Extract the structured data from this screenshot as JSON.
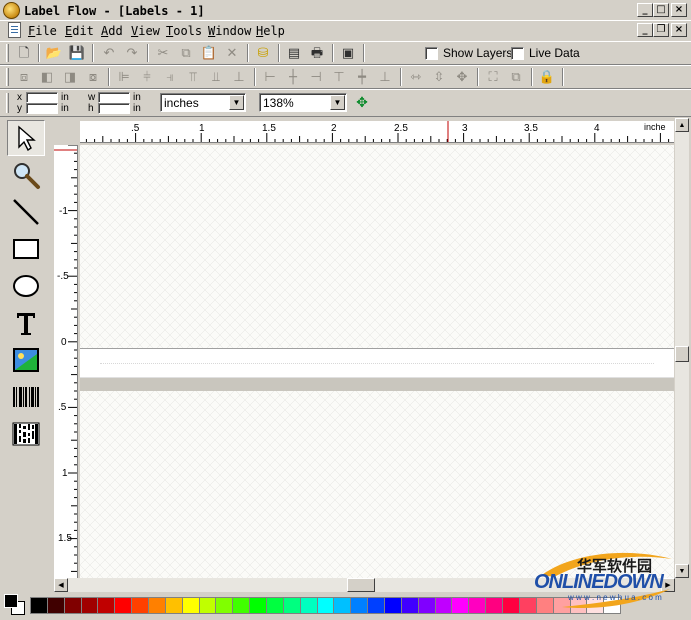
{
  "window": {
    "title": "Label Flow - [Labels - 1]"
  },
  "menus": [
    "File",
    "Edit",
    "Add",
    "View",
    "Tools",
    "Window",
    "Help"
  ],
  "toolbar1": {
    "show_layers": "Show Layers",
    "live_data": "Live Data",
    "show_layers_checked": false,
    "live_data_checked": false
  },
  "toolbar3": {
    "x_label": "x",
    "y_label": "y",
    "w_label": "w",
    "h_label": "h",
    "x_unit": "in",
    "y_unit": "in",
    "w_unit": "in",
    "h_unit": "in",
    "units_value": "inches",
    "zoom_value": "138%"
  },
  "h_ruler": {
    "labels": [
      ".5",
      "1",
      "1.5",
      "2",
      "2.5",
      "3",
      "3.5",
      "4"
    ],
    "unit": "inche"
  },
  "v_ruler": {
    "labels": [
      "-1",
      "-.5",
      "0",
      ".5",
      "1",
      "1.5"
    ]
  },
  "tools": [
    "select-arrow-icon",
    "zoom-magnifier-icon",
    "line-tool-icon",
    "rectangle-tool-icon",
    "ellipse-tool-icon",
    "text-tool-icon",
    "image-tool-icon",
    "barcode-tool-icon",
    "2d-barcode-tool-icon"
  ],
  "palette": [
    "#000000",
    "#400000",
    "#800000",
    "#a00000",
    "#c00000",
    "#ff0000",
    "#ff4000",
    "#ff8000",
    "#ffc000",
    "#ffff00",
    "#c0ff00",
    "#80ff00",
    "#40ff00",
    "#00ff00",
    "#00ff40",
    "#00ff80",
    "#00ffc0",
    "#00ffff",
    "#00c0ff",
    "#0080ff",
    "#0040ff",
    "#0000ff",
    "#4000ff",
    "#8000ff",
    "#c000ff",
    "#ff00ff",
    "#ff00c0",
    "#ff0080",
    "#ff0040",
    "#ff4060",
    "#ff8080",
    "#ffa0a0",
    "#ffc0c0",
    "#ffe0e0",
    "#ffffff"
  ],
  "watermark": {
    "line1": "华军软件园",
    "line2": "ONLINEDOWN",
    "line3": "w w w . n e w h u a . c o m"
  }
}
